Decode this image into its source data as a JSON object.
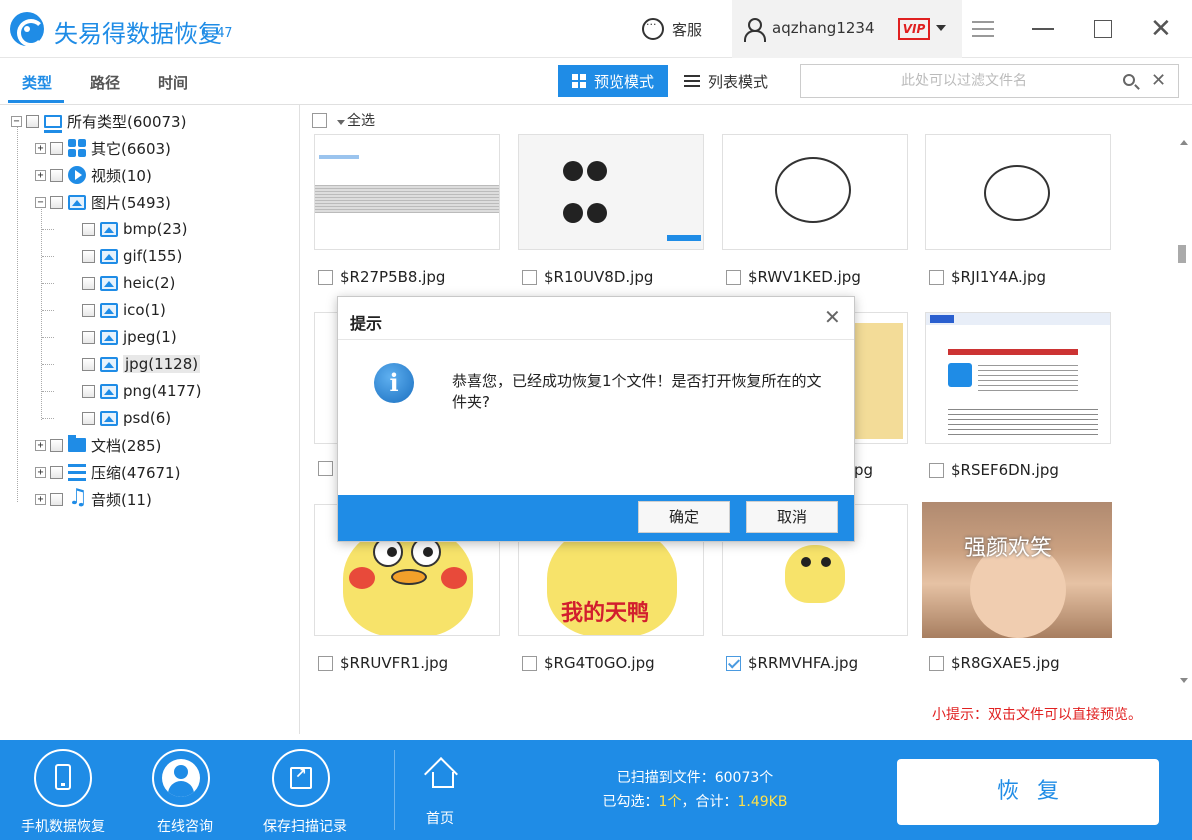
{
  "app": {
    "title": "失易得数据恢复",
    "version": "6.47"
  },
  "header": {
    "service_label": "客服",
    "username": "aqzhang1234",
    "vip_badge": "VIP"
  },
  "tabs": [
    {
      "label": "类型",
      "active": true
    },
    {
      "label": "路径",
      "active": false
    },
    {
      "label": "时间",
      "active": false
    }
  ],
  "view_modes": {
    "preview": "预览模式",
    "list": "列表模式",
    "active": "preview"
  },
  "search": {
    "placeholder": "此处可以过滤文件名",
    "value": ""
  },
  "tree": [
    {
      "label": "所有类型(60073)",
      "icon": "computer-icon",
      "level": 0,
      "expand": "−"
    },
    {
      "label": "其它(6603)",
      "icon": "apps-icon",
      "level": 1,
      "expand": "+"
    },
    {
      "label": "视频(10)",
      "icon": "video-icon",
      "level": 1,
      "expand": "+"
    },
    {
      "label": "图片(5493)",
      "icon": "image-icon",
      "level": 1,
      "expand": "−"
    },
    {
      "label": "bmp(23)",
      "icon": "image-icon",
      "level": 2
    },
    {
      "label": "gif(155)",
      "icon": "image-icon",
      "level": 2
    },
    {
      "label": "heic(2)",
      "icon": "image-icon",
      "level": 2
    },
    {
      "label": "ico(1)",
      "icon": "image-icon",
      "level": 2
    },
    {
      "label": "jpeg(1)",
      "icon": "image-icon",
      "level": 2
    },
    {
      "label": "jpg(1128)",
      "icon": "image-icon",
      "level": 2,
      "selected": true
    },
    {
      "label": "png(4177)",
      "icon": "image-icon",
      "level": 2
    },
    {
      "label": "psd(6)",
      "icon": "image-icon",
      "level": 2
    },
    {
      "label": "文档(285)",
      "icon": "folder-icon",
      "level": 1,
      "expand": "+"
    },
    {
      "label": "压缩(47671)",
      "icon": "archive-icon",
      "level": 1,
      "expand": "+"
    },
    {
      "label": "音频(11)",
      "icon": "music-icon",
      "level": 1,
      "expand": "+"
    }
  ],
  "select_all_label": "全选",
  "files": [
    {
      "name": "$R27P5B8.jpg",
      "checked": false
    },
    {
      "name": "$R10UV8D.jpg",
      "checked": false
    },
    {
      "name": "$RWV1KED.jpg",
      "checked": false
    },
    {
      "name": "$RJI1Y4A.jpg",
      "checked": false
    },
    {
      "name": "",
      "checked": false
    },
    {
      "name": "",
      "checked": false
    },
    {
      "name": "pg",
      "checked": false
    },
    {
      "name": "$RSEF6DN.jpg",
      "checked": false
    },
    {
      "name": "$RRUVFR1.jpg",
      "checked": false
    },
    {
      "name": "$RG4T0GO.jpg",
      "checked": false
    },
    {
      "name": "$RRMVHFA.jpg",
      "checked": true
    },
    {
      "name": "$R8GXAE5.jpg",
      "checked": false
    }
  ],
  "thumb_texts": {
    "duck_caption": "我的天鸭",
    "photo_caption": "强颜欢笑"
  },
  "tip": "小提示：双击文件可以直接预览。",
  "dialog": {
    "title": "提示",
    "message": "恭喜您，已经成功恢复1个文件！是否打开恢复所在的文件夹?",
    "ok": "确定",
    "cancel": "取消"
  },
  "bottom": {
    "phone_recovery": "手机数据恢复",
    "online_consult": "在线咨询",
    "save_scan": "保存扫描记录",
    "home": "首页",
    "scanned_label": "已扫描到文件：",
    "scanned_value": "60073个",
    "selected_label": "已勾选：",
    "selected_value": "1个",
    "total_label": "，合计：",
    "total_value": "1.49KB",
    "recover": "恢复"
  },
  "colors": {
    "accent": "#1f8ce6",
    "tip": "#e02020",
    "highlight": "#ffe14a"
  }
}
